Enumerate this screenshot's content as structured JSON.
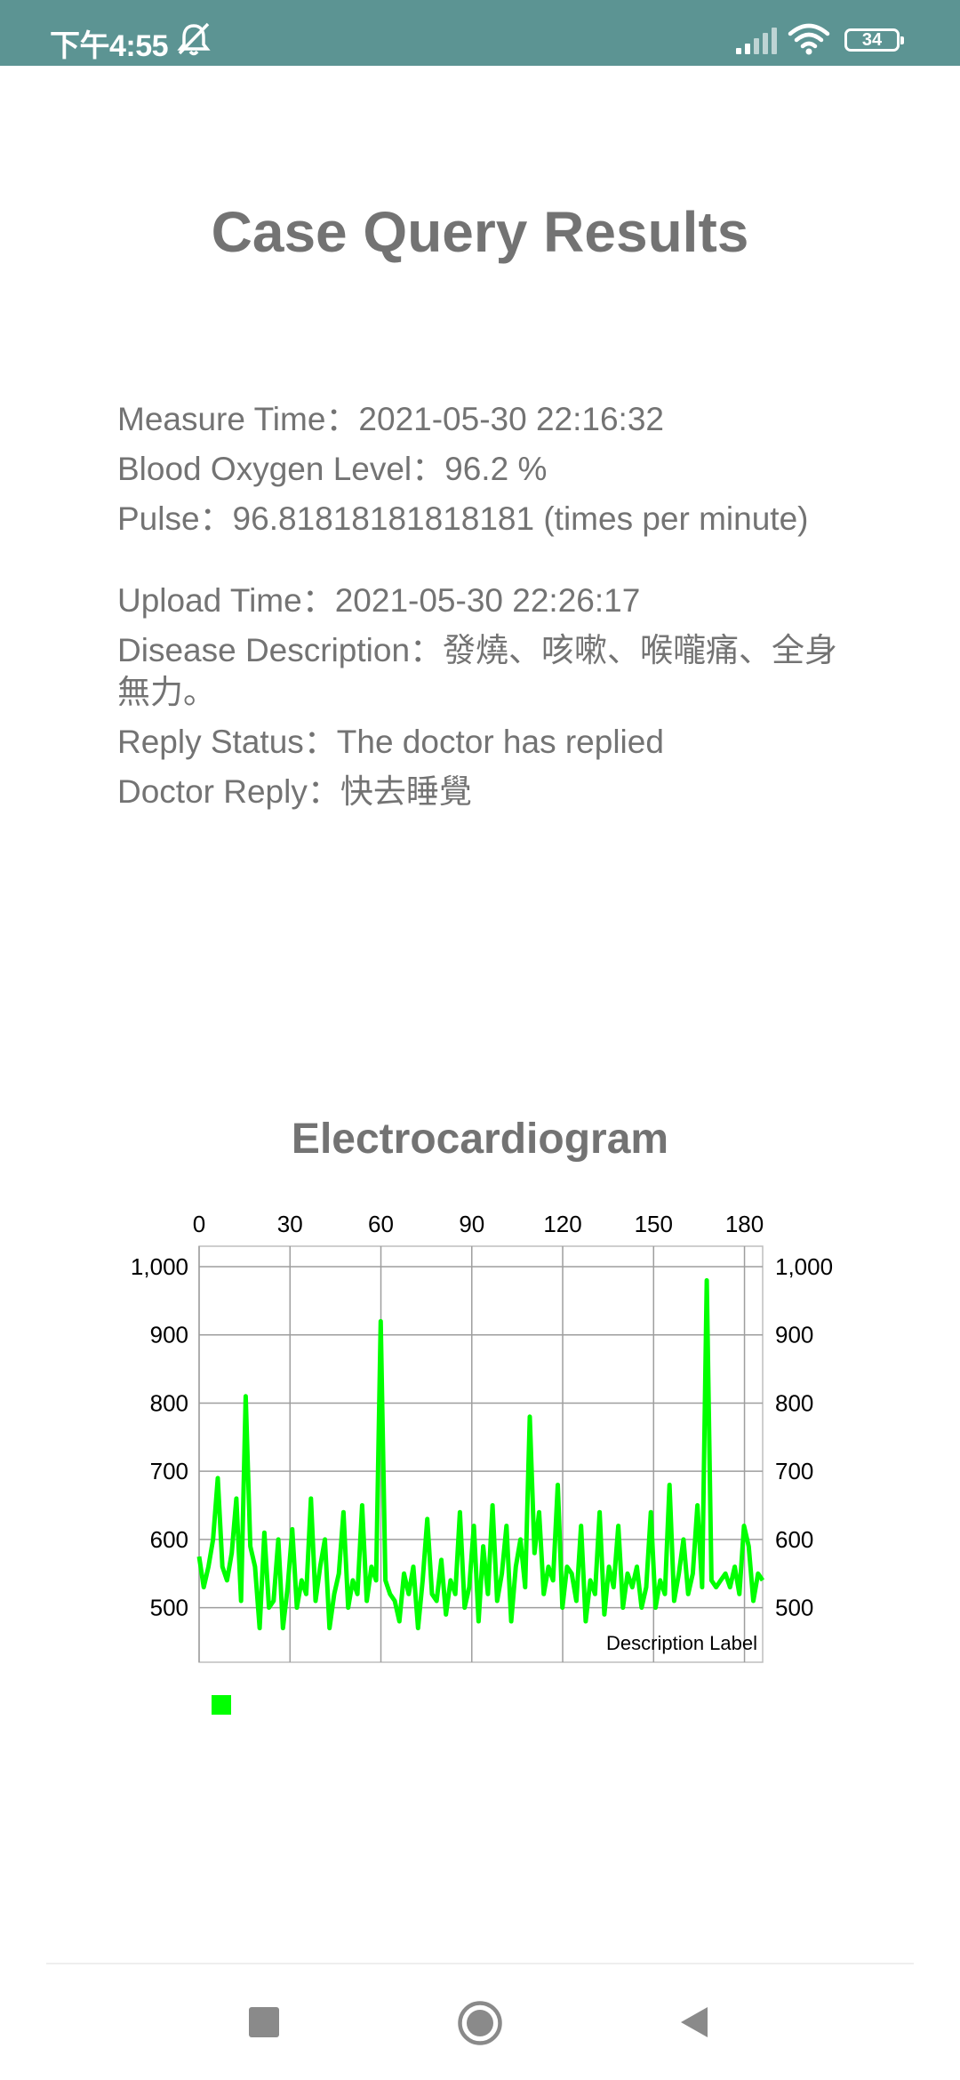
{
  "status_bar": {
    "time": "下午4:55",
    "battery": "34",
    "background": "#5c9493"
  },
  "page": {
    "title": "Case Query Results"
  },
  "record": {
    "measure_time": "Measure Time：2021-05-30 22:16:32",
    "blood_oxygen": "Blood Oxygen Level：96.2 %",
    "pulse": "Pulse：96.81818181818181 (times per minute)",
    "upload_time": "Upload Time：2021-05-30 22:26:17",
    "disease_description": "Disease Description：發燒、咳嗽、喉嚨痛、全身無力。",
    "reply_status": "Reply Status：The doctor has replied",
    "doctor_reply": "Doctor Reply：快去睡覺"
  },
  "chart_data": {
    "type": "line",
    "title": "Electrocardiogram",
    "description_label": "Description Label",
    "xlim": [
      0,
      186
    ],
    "ylim": [
      420,
      1030
    ],
    "x_ticks": [
      "0",
      "30",
      "60",
      "90",
      "120",
      "150",
      "180"
    ],
    "y_ticks": [
      "500",
      "600",
      "700",
      "800",
      "900",
      "1,000"
    ],
    "grid": true,
    "legend": "bottom-left",
    "series": [
      {
        "color": "#00ff00",
        "values": [
          575,
          530,
          560,
          600,
          690,
          560,
          540,
          580,
          660,
          510,
          810,
          590,
          560,
          470,
          610,
          500,
          510,
          600,
          470,
          530,
          615,
          500,
          540,
          520,
          660,
          510,
          560,
          600,
          470,
          520,
          550,
          640,
          500,
          540,
          520,
          650,
          510,
          560,
          540,
          920,
          540,
          520,
          510,
          480,
          550,
          520,
          560,
          470,
          540,
          630,
          520,
          510,
          570,
          490,
          540,
          520,
          640,
          500,
          530,
          620,
          480,
          590,
          520,
          650,
          510,
          550,
          620,
          480,
          560,
          600,
          530,
          780,
          580,
          640,
          520,
          560,
          540,
          680,
          500,
          560,
          550,
          510,
          620,
          480,
          540,
          520,
          640,
          490,
          560,
          530,
          620,
          500,
          550,
          530,
          560,
          500,
          530,
          640,
          500,
          540,
          520,
          680,
          510,
          550,
          600,
          520,
          550,
          650,
          530,
          980,
          540,
          530,
          540,
          550,
          530,
          560,
          520,
          620,
          590,
          510,
          550,
          540
        ]
      }
    ]
  },
  "nav": {
    "recents": "recents-icon",
    "home": "home-icon",
    "back": "back-icon"
  }
}
